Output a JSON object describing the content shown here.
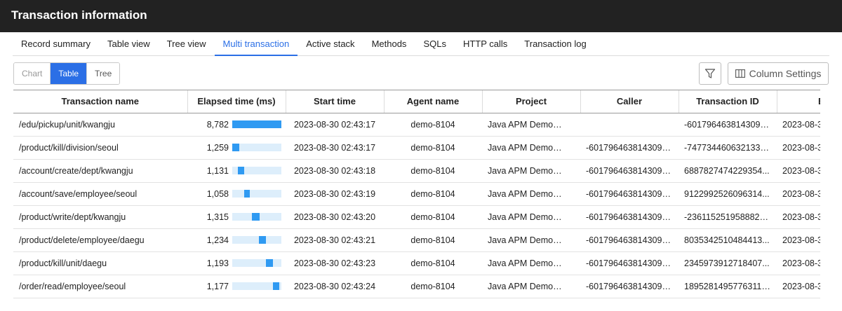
{
  "window": {
    "title": "Transaction information"
  },
  "tabs": [
    {
      "label": "Record summary",
      "active": false
    },
    {
      "label": "Table view",
      "active": false
    },
    {
      "label": "Tree view",
      "active": false
    },
    {
      "label": "Multi transaction",
      "active": true
    },
    {
      "label": "Active stack",
      "active": false
    },
    {
      "label": "Methods",
      "active": false
    },
    {
      "label": "SQLs",
      "active": false
    },
    {
      "label": "HTTP calls",
      "active": false
    },
    {
      "label": "Transaction log",
      "active": false
    }
  ],
  "view_toggle": {
    "chart": "Chart",
    "table": "Table",
    "tree": "Tree",
    "selected": "Table"
  },
  "toolbar": {
    "column_settings_label": "Column Settings",
    "filter_icon": "filter-icon",
    "columns_icon": "columns-icon"
  },
  "colors": {
    "accent": "#2b6fe6",
    "bar_fill": "#2f9af2",
    "bar_track": "#ddeefb",
    "header_bg": "#222222"
  },
  "table": {
    "columns": [
      "Transaction name",
      "Elapsed time (ms)",
      "Start time",
      "Agent name",
      "Project",
      "Caller",
      "Transaction ID",
      "End"
    ],
    "rows": [
      {
        "name": "/edu/pickup/unit/kwangju",
        "elapsed": "8,782",
        "bar_offset": 0.0,
        "bar_width": 1.0,
        "start": "2023-08-30 02:43:17",
        "agent": "demo-8104",
        "project": "Java APM Demo",
        "project_id": "5490",
        "caller": "",
        "txid": "-6017964638143090...",
        "end": "2023-08-3"
      },
      {
        "name": "/product/kill/division/seoul",
        "elapsed": "1,259",
        "bar_offset": 0.0,
        "bar_width": 0.143,
        "start": "2023-08-30 02:43:17",
        "agent": "demo-8104",
        "project": "Java APM Demo",
        "project_id": "5490",
        "caller": "-6017964638143090...",
        "txid": "-7477344606321332...",
        "end": "2023-08-3"
      },
      {
        "name": "/account/create/dept/kwangju",
        "elapsed": "1,131",
        "bar_offset": 0.114,
        "bar_width": 0.129,
        "start": "2023-08-30 02:43:18",
        "agent": "demo-8104",
        "project": "Java APM Demo",
        "project_id": "5490",
        "caller": "-6017964638143090...",
        "txid": "6887827474229354...",
        "end": "2023-08-3"
      },
      {
        "name": "/account/save/employee/seoul",
        "elapsed": "1,058",
        "bar_offset": 0.243,
        "bar_width": 0.12,
        "start": "2023-08-30 02:43:19",
        "agent": "demo-8104",
        "project": "Java APM Demo",
        "project_id": "5490",
        "caller": "-6017964638143090...",
        "txid": "9122992526096314...",
        "end": "2023-08-3"
      },
      {
        "name": "/product/write/dept/kwangju",
        "elapsed": "1,315",
        "bar_offset": 0.4,
        "bar_width": 0.15,
        "start": "2023-08-30 02:43:20",
        "agent": "demo-8104",
        "project": "Java APM Demo",
        "project_id": "5490",
        "caller": "-6017964638143090...",
        "txid": "-2361152519588825...",
        "end": "2023-08-3"
      },
      {
        "name": "/product/delete/employee/daegu",
        "elapsed": "1,234",
        "bar_offset": 0.543,
        "bar_width": 0.14,
        "start": "2023-08-30 02:43:21",
        "agent": "demo-8104",
        "project": "Java APM Demo",
        "project_id": "5490",
        "caller": "-6017964638143090...",
        "txid": "8035342510484413...",
        "end": "2023-08-3"
      },
      {
        "name": "/product/kill/unit/daegu",
        "elapsed": "1,193",
        "bar_offset": 0.686,
        "bar_width": 0.136,
        "start": "2023-08-30 02:43:23",
        "agent": "demo-8104",
        "project": "Java APM Demo",
        "project_id": "5490",
        "caller": "-6017964638143090...",
        "txid": "2345973912718407...",
        "end": "2023-08-3"
      },
      {
        "name": "/order/read/employee/seoul",
        "elapsed": "1,177",
        "bar_offset": 0.829,
        "bar_width": 0.134,
        "start": "2023-08-30 02:43:24",
        "agent": "demo-8104",
        "project": "Java APM Demo",
        "project_id": "5490",
        "caller": "-6017964638143090...",
        "txid": "189528149577631139",
        "end": "2023-08-3"
      }
    ]
  }
}
